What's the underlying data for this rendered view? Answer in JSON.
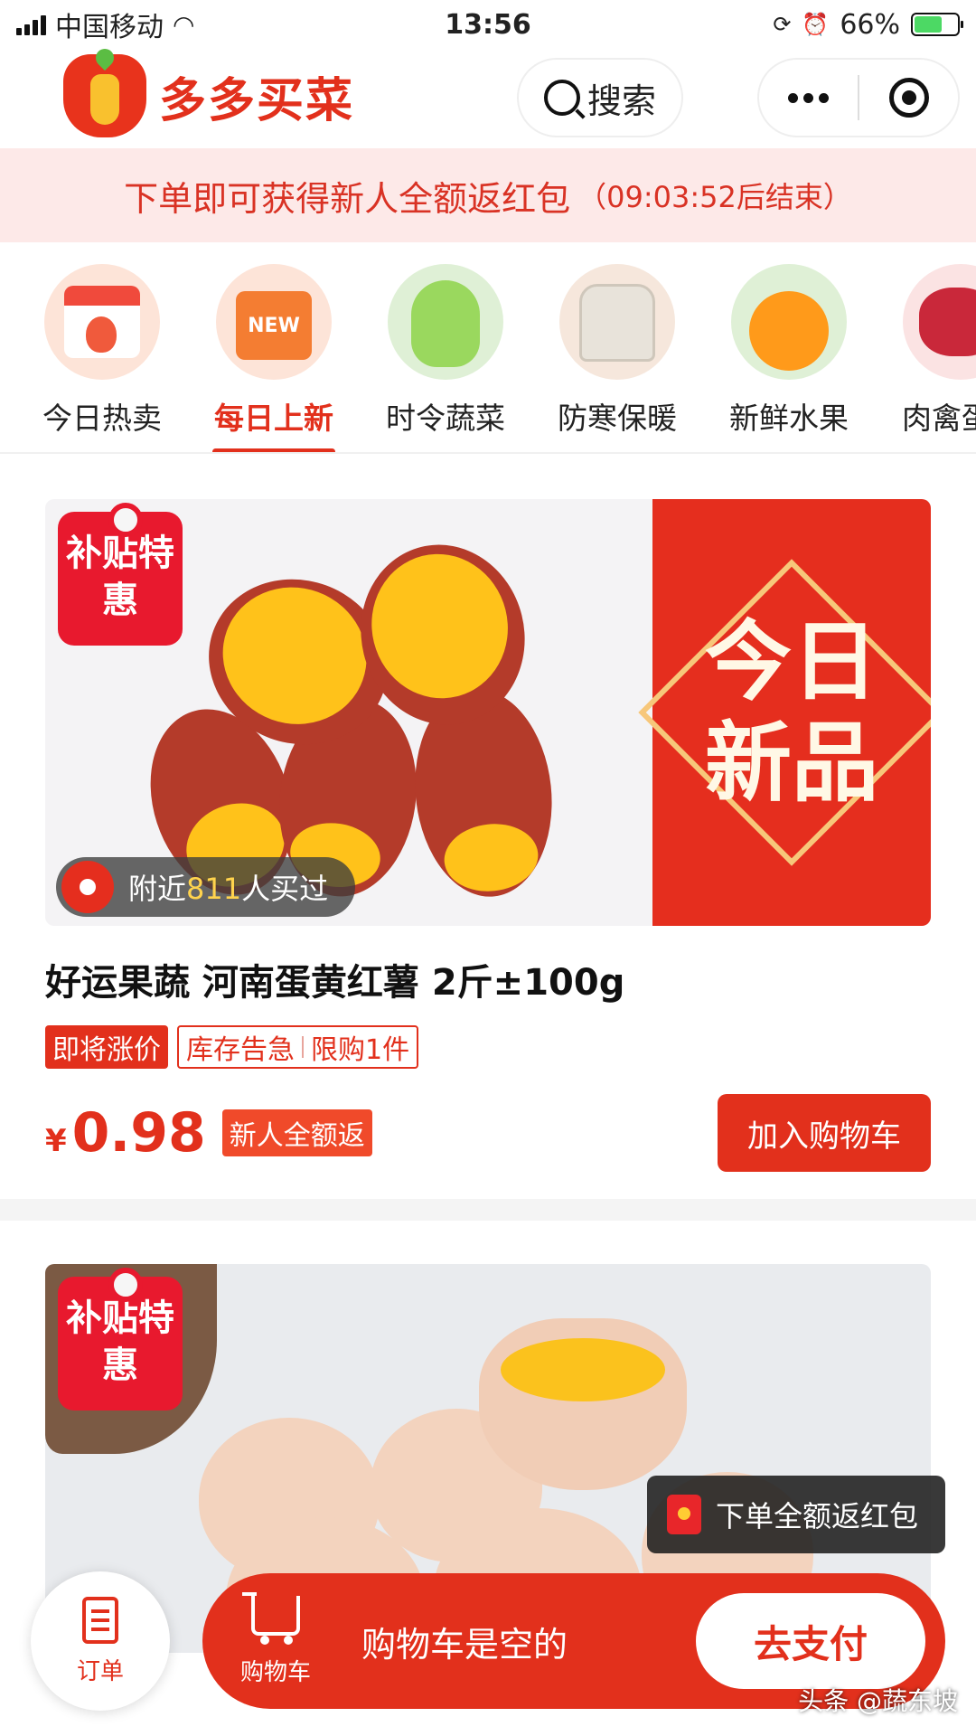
{
  "status_bar": {
    "carrier": "中国移动",
    "time": "13:56",
    "battery_percent": "66%",
    "battery_level": 0.66
  },
  "header": {
    "app_name": "多多买菜",
    "search_label": "搜索"
  },
  "promo_banner": {
    "text": "下单即可获得新人全额返红包",
    "countdown": "（09:03:52后结束）"
  },
  "categories": [
    {
      "label": "今日热卖",
      "icon": "calendar-fire-icon"
    },
    {
      "label": "每日上新",
      "icon": "new-bag-icon",
      "badge": "NEW",
      "active": true
    },
    {
      "label": "时令蔬菜",
      "icon": "cabbage-icon"
    },
    {
      "label": "防寒保暖",
      "icon": "jacket-icon"
    },
    {
      "label": "新鲜水果",
      "icon": "orange-icon"
    },
    {
      "label": "肉禽蛋",
      "icon": "meat-icon"
    }
  ],
  "products": [
    {
      "subsidy_tag": "补贴特惠",
      "banner_text": "今日新品",
      "nearby_prefix": "附近",
      "nearby_count": "811",
      "nearby_suffix": "人买过",
      "title": "好运果蔬 河南蛋黄红薯 2斤±100g",
      "tag_urgent": "即将涨价",
      "tag_stock": "库存告急",
      "tag_limit": "限购1件",
      "currency": "¥",
      "price": "0.98",
      "return_tag": "新人全额返",
      "add_cart_label": "加入购物车"
    },
    {
      "subsidy_tag": "补贴特惠"
    }
  ],
  "red_packet_tip": "下单全额返红包",
  "bottom_bar": {
    "order_label": "订单",
    "cart_label": "购物车",
    "cart_status": "购物车是空的",
    "pay_label": "去支付"
  },
  "watermark": "头条 @蔬东坡",
  "colors": {
    "brand_red": "#e2301c",
    "promo_bg": "#fde9e8"
  }
}
